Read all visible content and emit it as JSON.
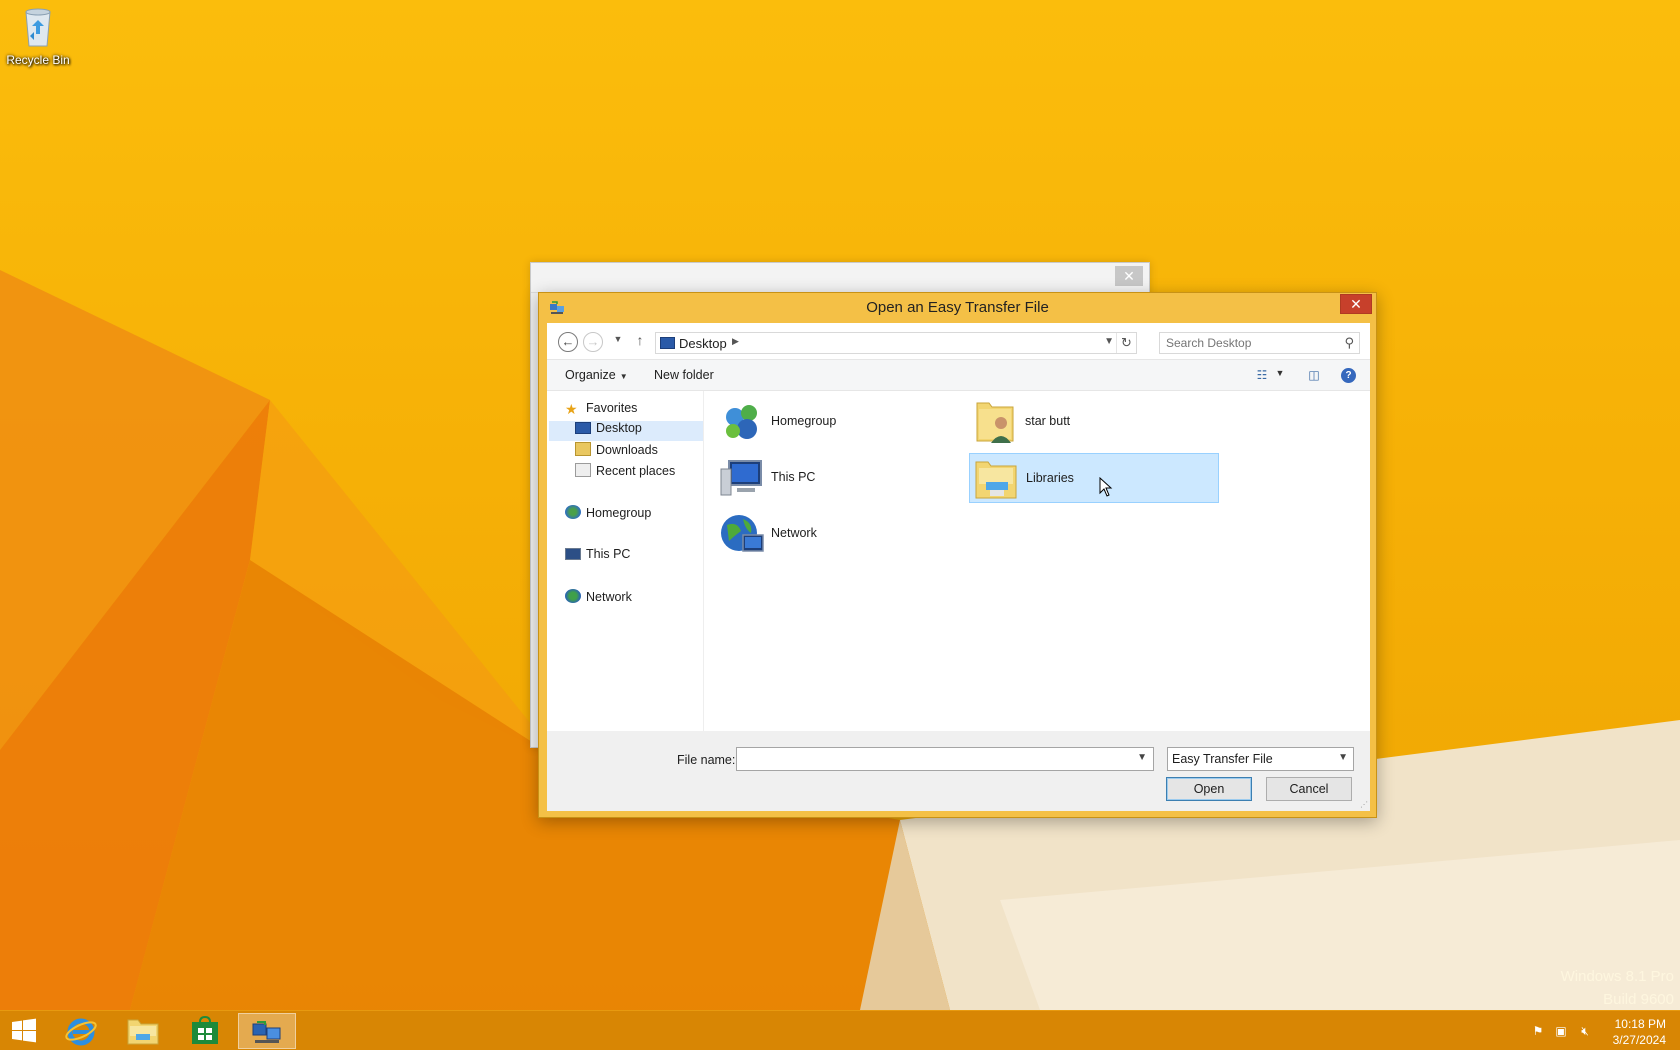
{
  "desktop": {
    "recycle_bin_label": "Recycle Bin",
    "watermark_line1": "Windows 8.1 Pro",
    "watermark_line2": "Build 9600"
  },
  "background_window": {
    "close_glyph": "✕"
  },
  "dialog": {
    "title": "Open an Easy Transfer File",
    "close_glyph": "✕",
    "address": {
      "location": "Desktop",
      "search_placeholder": "Search Desktop"
    },
    "toolbar": {
      "organize_label": "Organize",
      "new_folder_label": "New folder"
    },
    "nav_pane": {
      "favorites": "Favorites",
      "desktop": "Desktop",
      "downloads": "Downloads",
      "recent_places": "Recent places",
      "homegroup": "Homegroup",
      "this_pc": "This PC",
      "network": "Network"
    },
    "files": {
      "homegroup": "Homegroup",
      "this_pc": "This PC",
      "network": "Network",
      "star_butt": "star butt",
      "libraries": "Libraries"
    },
    "bottom": {
      "file_name_label": "File name:",
      "file_name_value": "",
      "file_type": "Easy Transfer File",
      "open_label": "Open",
      "cancel_label": "Cancel"
    }
  },
  "taskbar": {
    "time": "10:18 PM",
    "date": "3/27/2024"
  },
  "colors": {
    "wallpaper": "#f6b208",
    "taskbar": "#d68304",
    "dialog_frame": "#f4c046",
    "selection": "#cce8ff",
    "close_red": "#c7402b"
  }
}
